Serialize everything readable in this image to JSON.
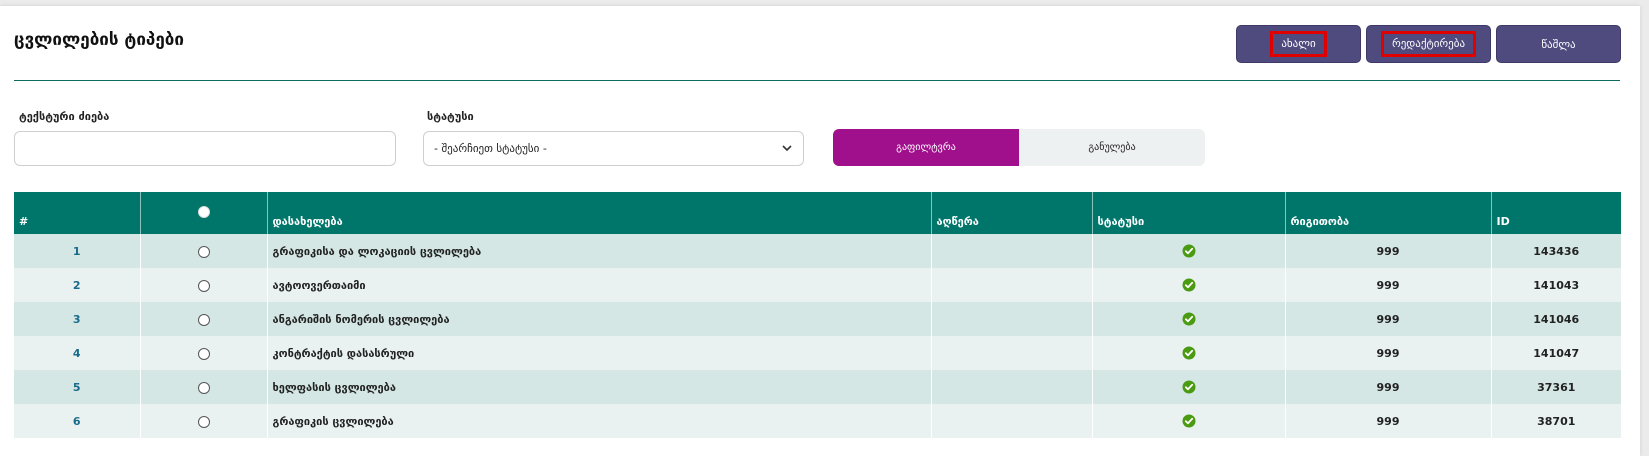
{
  "page": {
    "title": "ცვლილების ტიპები"
  },
  "toolbar": {
    "new_label": "ახალი",
    "edit_label": "რედაქტირება",
    "delete_label": "წაშლა"
  },
  "filters": {
    "text_search_label": "ტექსტური ძიება",
    "text_search_value": "",
    "status_label": "სტატუსი",
    "status_selected": "- შეარჩიეთ სტატუსი -",
    "filter_button": "გაფილტვრა",
    "reset_button": "განულება"
  },
  "table": {
    "columns": {
      "num": "#",
      "name": "დასახელება",
      "description": "აღწერა",
      "status": "სტატუსი",
      "order": "რიგითობა",
      "id": "ID"
    },
    "rows": [
      {
        "num": "1",
        "name": "გრაფიკისა და ლოკაციის ცვლილება",
        "description": "",
        "status": "active",
        "order": "999",
        "id": "143436"
      },
      {
        "num": "2",
        "name": "ავტოოვერთაიმი",
        "description": "",
        "status": "active",
        "order": "999",
        "id": "141043"
      },
      {
        "num": "3",
        "name": "ანგარიშის ნომერის ცვლილება",
        "description": "",
        "status": "active",
        "order": "999",
        "id": "141046"
      },
      {
        "num": "4",
        "name": "კონტრაქტის დასასრული",
        "description": "",
        "status": "active",
        "order": "999",
        "id": "141047"
      },
      {
        "num": "5",
        "name": "ხელფასის ცვლილება",
        "description": "",
        "status": "active",
        "order": "999",
        "id": "37361"
      },
      {
        "num": "6",
        "name": "გრაფიკის ცვლილება",
        "description": "",
        "status": "active",
        "order": "999",
        "id": "38701"
      }
    ]
  },
  "colors": {
    "header": "#00766b",
    "accent_button": "#4f4b7e",
    "filter_button": "#a1108c",
    "status_ok": "#4a9a12"
  },
  "icons": {
    "status_active": "check-circle-icon",
    "select_chevron": "chevron-down-icon"
  }
}
